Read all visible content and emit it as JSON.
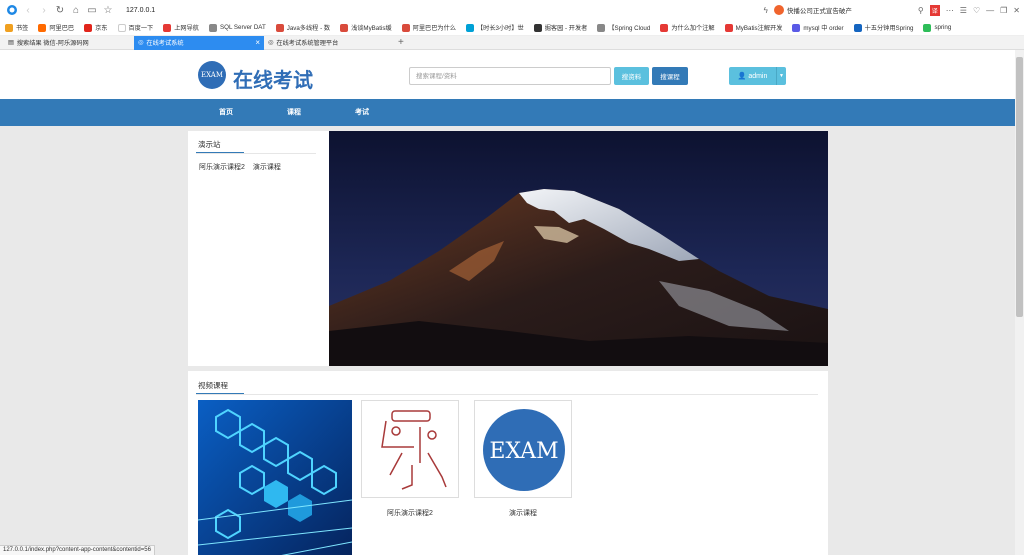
{
  "browser": {
    "url": "127.0.0.1",
    "news_text": "快播公司正式宣告破产",
    "bookmarks": [
      {
        "label": "书签",
        "color": "#f0a020"
      },
      {
        "label": "阿里巴巴",
        "color": "#ff6a00"
      },
      {
        "label": "京东",
        "color": "#e1251b"
      },
      {
        "label": "百度一下",
        "color": "#ffffff"
      },
      {
        "label": "上网导航",
        "color": "#e53935"
      },
      {
        "label": "SQL Server DAT",
        "color": "#888888"
      },
      {
        "label": "Java多线程 - 数",
        "color": "#d94b3c"
      },
      {
        "label": "浅谈MyBatis缓",
        "color": "#d94b3c"
      },
      {
        "label": "阿里巴巴为什么",
        "color": "#d94b3c"
      },
      {
        "label": "【时长3小时】世",
        "color": "#00a1d6"
      },
      {
        "label": "掘客园 - 开发者",
        "color": "#333333"
      },
      {
        "label": "【Spring Cloud",
        "color": "#888888"
      },
      {
        "label": "为什么加个注解",
        "color": "#e53935"
      },
      {
        "label": "MyBatis注解开发",
        "color": "#e53935"
      },
      {
        "label": "mysql 中 order",
        "color": "#5a5ae6"
      },
      {
        "label": "十五分钟用Spring",
        "color": "#1565c0"
      },
      {
        "label": "spring",
        "color": "#2ebd59"
      }
    ],
    "tabs": [
      {
        "label": "搜索结果 微信-阿乐源码网"
      },
      {
        "label": "在线考试系统"
      },
      {
        "label": "在线考试系统管理平台"
      }
    ],
    "status_url": "127.0.0.1/index.php?content-app-content&contentid=56"
  },
  "site": {
    "logo_text": "EXAM",
    "title": "在线考试",
    "search_placeholder": "搜索课程/资料",
    "search_data_label": "搜资料",
    "search_course_label": "搜课程",
    "user_label": "admin",
    "nav": [
      "首页",
      "课程",
      "考试"
    ]
  },
  "demo_site": {
    "heading": "演示站",
    "courses": [
      "阿乐演示课程2",
      "演示课程"
    ]
  },
  "video_section": {
    "heading": "视频课程",
    "items": [
      {
        "caption": "阿乐演示课程2",
        "thumb": "logo-sketch"
      },
      {
        "caption": "演示课程",
        "thumb": "exam-logo",
        "text": "EXAM"
      }
    ]
  },
  "colors": {
    "brand": "#337ab7",
    "info": "#5bc0de",
    "tab_active": "#2d8cf0"
  }
}
